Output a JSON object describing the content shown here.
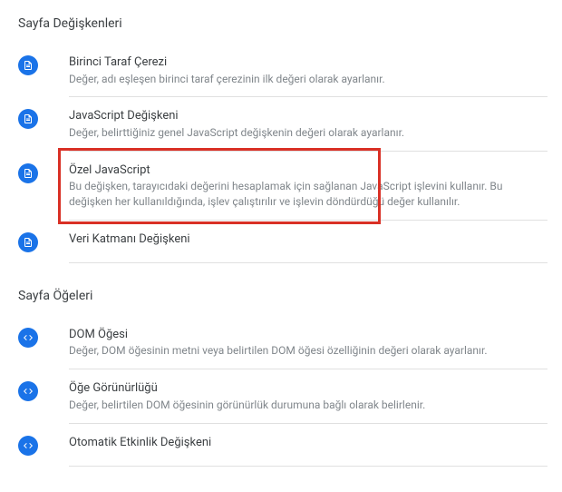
{
  "sections": [
    {
      "title": "Sayfa Değişkenleri",
      "items": [
        {
          "icon": "page",
          "title": "Birinci Taraf Çerezi",
          "desc": "Değer, adı eşleşen birinci taraf çerezinin ilk değeri olarak ayarlanır.",
          "highlighted": false
        },
        {
          "icon": "page",
          "title": "JavaScript Değişkeni",
          "desc": "Değer, belirttiğiniz genel JavaScript değişkenin değeri olarak ayarlanır.",
          "highlighted": false
        },
        {
          "icon": "page",
          "title": "Özel JavaScript",
          "desc": "Bu değişken, tarayıcıdaki değerini hesaplamak için sağlanan JavaScript işlevini kullanır. Bu değişken her kullanıldığında, işlev çalıştırılır ve işlevin döndürdüğü değer kullanılır.",
          "highlighted": true
        },
        {
          "icon": "page",
          "title": "Veri Katmanı Değişkeni",
          "desc": "",
          "highlighted": false
        }
      ]
    },
    {
      "title": "Sayfa Öğeleri",
      "items": [
        {
          "icon": "code",
          "title": "DOM Öğesi",
          "desc": "Değer, DOM öğesinin metni veya belirtilen DOM öğesi özelliğinin değeri olarak ayarlanır.",
          "highlighted": false
        },
        {
          "icon": "code",
          "title": "Öğe Görünürlüğü",
          "desc": "Değer, belirtilen DOM öğesinin görünürlük durumuna bağlı olarak belirlenir.",
          "highlighted": false
        },
        {
          "icon": "code",
          "title": "Otomatik Etkinlik Değişkeni",
          "desc": "",
          "highlighted": false
        }
      ]
    }
  ]
}
